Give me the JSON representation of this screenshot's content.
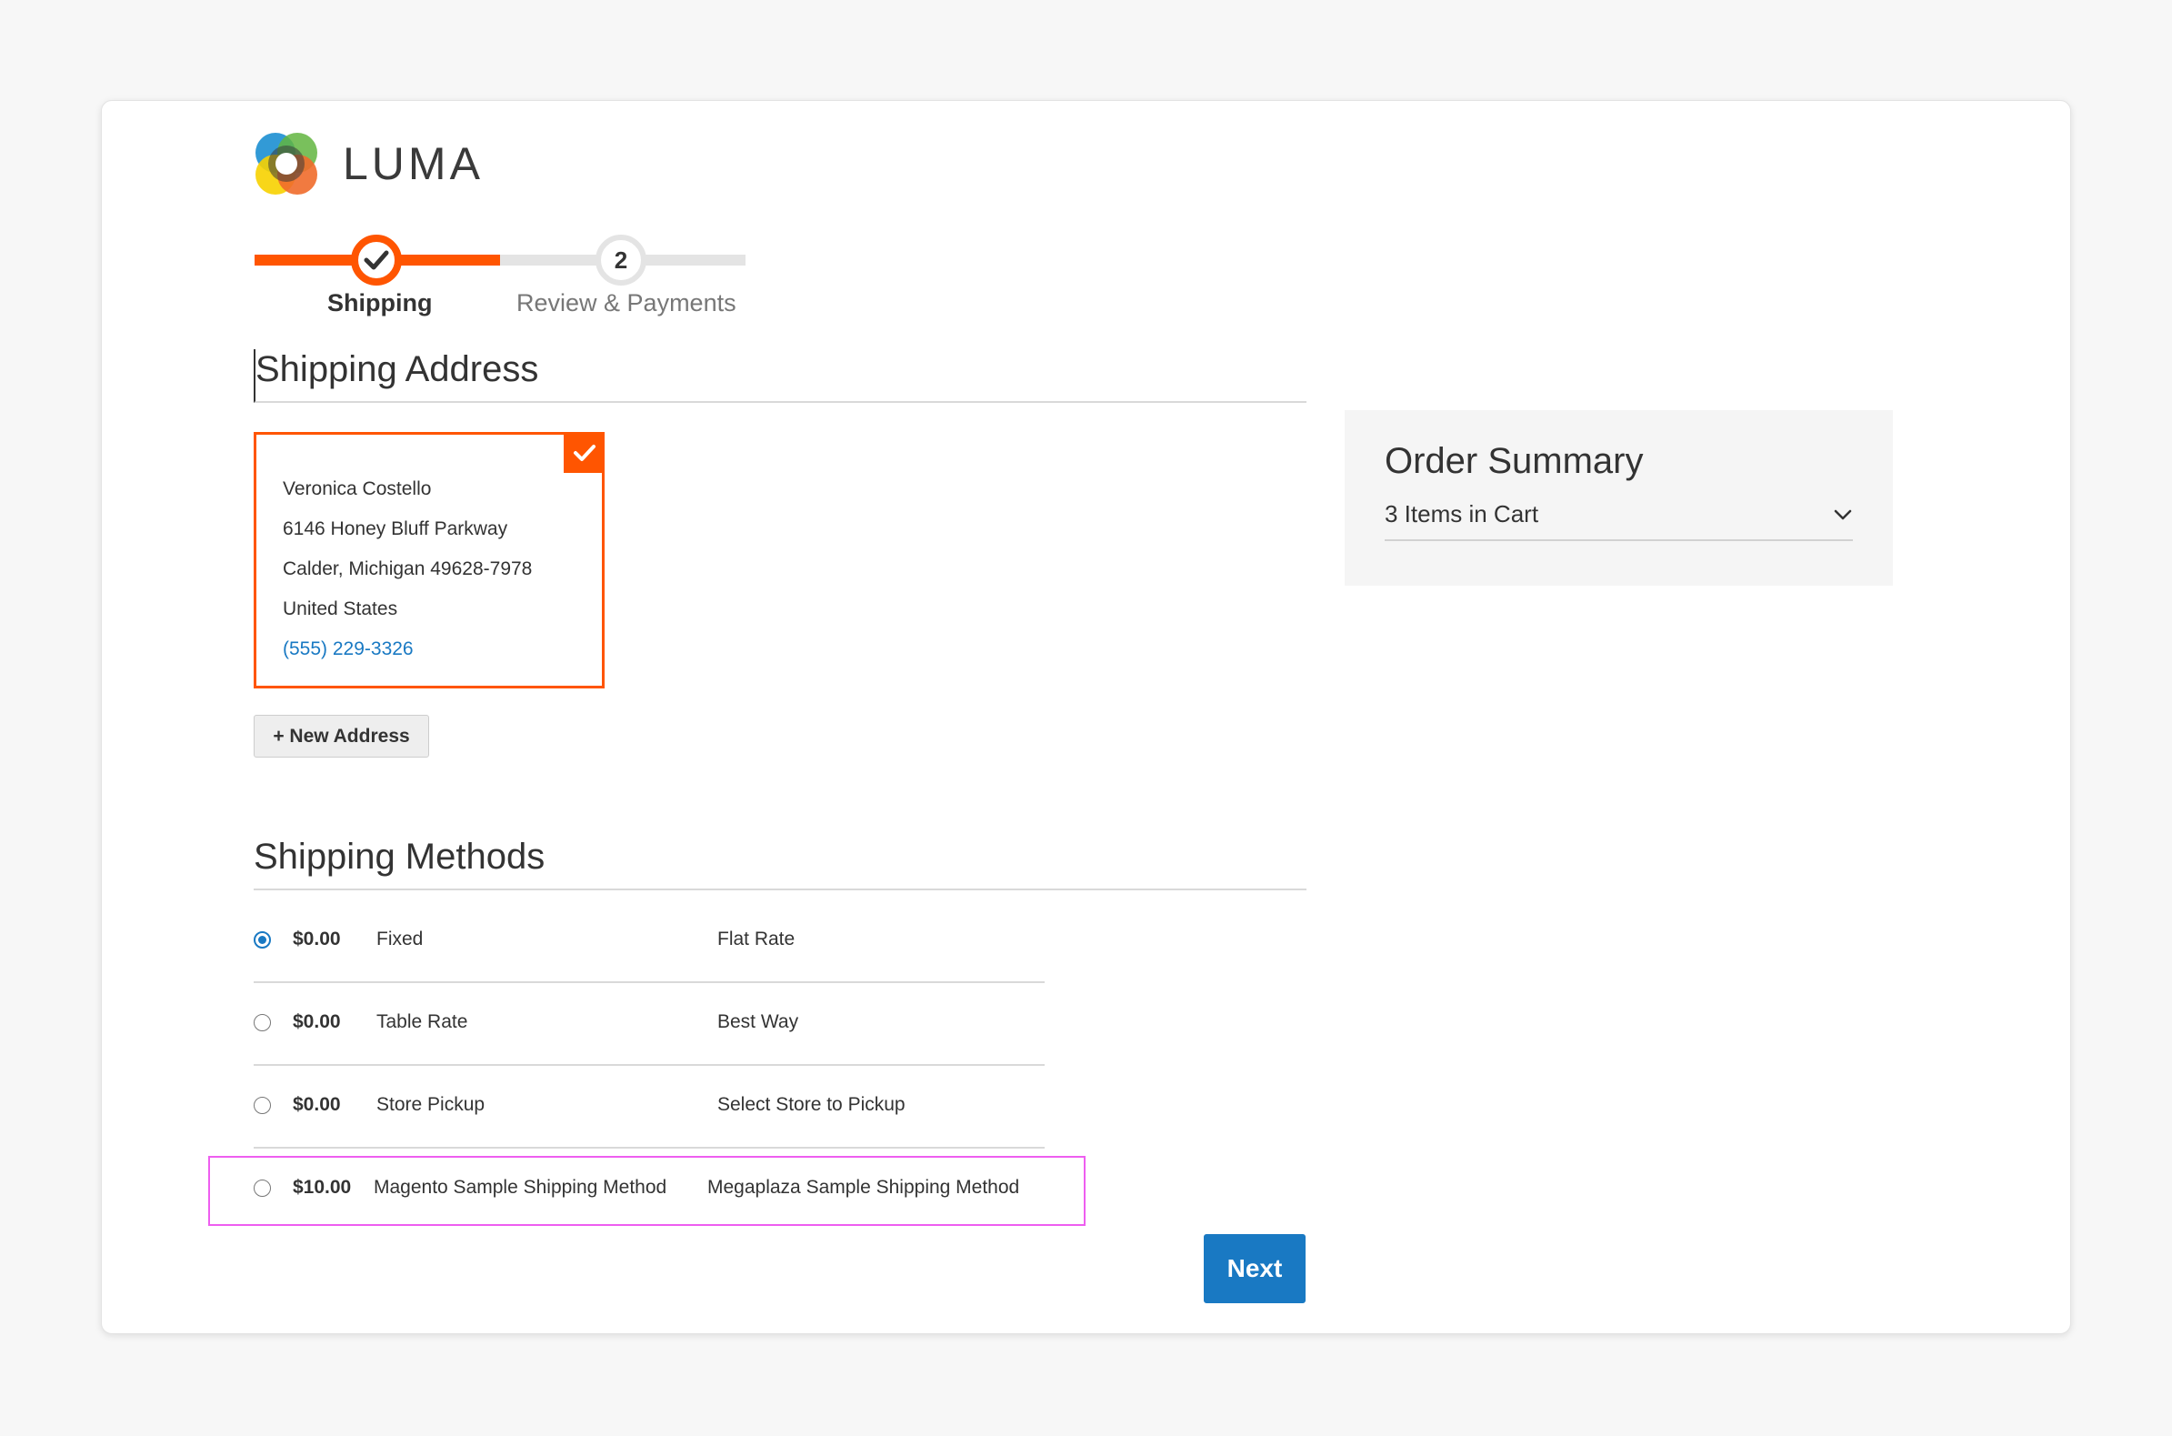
{
  "brand": {
    "name": "LUMA",
    "logo_icon": "luma-logo-icon"
  },
  "progress": {
    "steps": [
      {
        "number": "",
        "label": "Shipping",
        "state": "active"
      },
      {
        "number": "2",
        "label": "Review & Payments",
        "state": "pending"
      }
    ],
    "accent": "#ff5501"
  },
  "shipping_address": {
    "title": "Shipping Address",
    "selected": true,
    "name": "Veronica Costello",
    "street": "6146 Honey Bluff Parkway",
    "city_line": "Calder, Michigan 49628-7978",
    "country": "United States",
    "phone": "(555) 229-3326",
    "new_address_label": "+ New Address"
  },
  "shipping_methods": {
    "title": "Shipping Methods",
    "rows": [
      {
        "price": "$0.00",
        "carrier": "Fixed",
        "method": "Flat Rate",
        "selected": true
      },
      {
        "price": "$0.00",
        "carrier": "Table Rate",
        "method": "Best Way",
        "selected": false
      },
      {
        "price": "$0.00",
        "carrier": "Store Pickup",
        "method": "Select Store to Pickup",
        "selected": false
      },
      {
        "price": "$10.00",
        "carrier": "Magento Sample Shipping Method",
        "method": "Megaplaza Sample Shipping Method",
        "selected": false,
        "highlighted": true
      }
    ],
    "next_label": "Next",
    "button_color": "#1979c3",
    "highlight_color": "#ee5ef0"
  },
  "order_summary": {
    "title": "Order Summary",
    "items_label": "3 Items in Cart",
    "toggle_icon": "chevron-down-icon"
  }
}
